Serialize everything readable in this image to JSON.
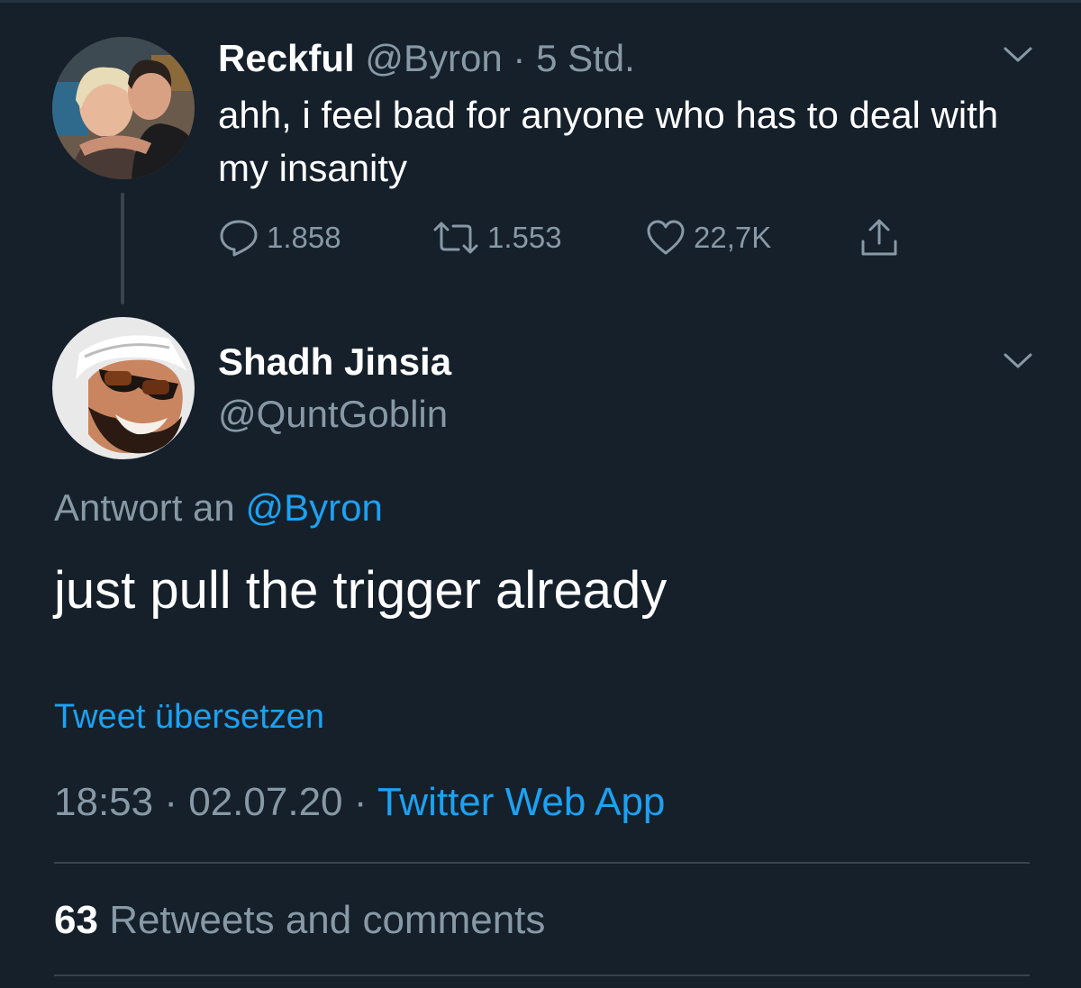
{
  "colors": {
    "background": "#15202b",
    "primary_text": "#ffffff",
    "secondary_text": "#8899a6",
    "accent": "#1da1f2",
    "divider": "#38444d"
  },
  "parent_tweet": {
    "name": "Reckful",
    "handle": "@Byron",
    "separator": "·",
    "time": "5 Std.",
    "text": "ahh, i feel bad for anyone who has to deal with my insanity",
    "menu_icon": "chevron-down-icon",
    "actions": {
      "reply": {
        "icon": "comment-icon",
        "count": "1.858"
      },
      "retweet": {
        "icon": "retweet-icon",
        "count": "1.553"
      },
      "like": {
        "icon": "heart-icon",
        "count": "22,7K"
      },
      "share": {
        "icon": "share-icon"
      }
    }
  },
  "reply_tweet": {
    "name": "Shadh Jinsia",
    "handle": "@QuntGoblin",
    "menu_icon": "chevron-down-icon",
    "replying_to_label": "Antwort an",
    "replying_to_handle": "@Byron",
    "text": "just pull the trigger already",
    "translate_label": "Tweet übersetzen",
    "time": "18:53",
    "separator": "·",
    "date": "02.07.20",
    "source": "Twitter Web App"
  },
  "stats": {
    "count": "63",
    "label": "Retweets and comments"
  }
}
